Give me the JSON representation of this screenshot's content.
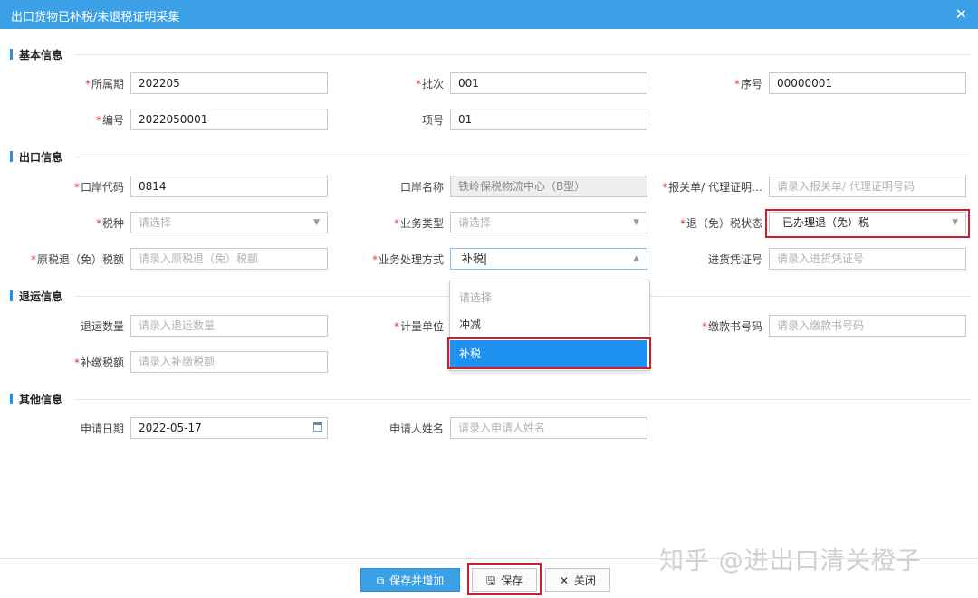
{
  "dialog": {
    "title": "出口货物已补税/未退税证明采集",
    "close_icon": "close-icon"
  },
  "sections": {
    "basic": "基本信息",
    "export": "出口信息",
    "return": "退运信息",
    "other": "其他信息"
  },
  "basic": {
    "period_label": "所属期",
    "period_value": "202205",
    "batch_label": "批次",
    "batch_value": "001",
    "seq_label": "序号",
    "seq_value": "00000001",
    "code_label": "编号",
    "code_value": "2022050001",
    "item_label": "项号",
    "item_value": "01"
  },
  "export": {
    "port_code_label": "口岸代码",
    "port_code_value": "0814",
    "port_name_label": "口岸名称",
    "port_name_value": "铁岭保税物流中心（B型）",
    "declaration_label": "报关单/ 代理证明…",
    "declaration_placeholder": "请录入报关单/ 代理证明号码",
    "tax_type_label": "税种",
    "tax_type_placeholder": "请选择",
    "business_type_label": "业务类型",
    "business_type_placeholder": "请选择",
    "refund_status_label": "退（免）税状态",
    "refund_status_value": "已办理退（免）税",
    "orig_refund_label": "原税退（免）税额",
    "orig_refund_placeholder": "请录入原税退（免）税额",
    "handling_label": "业务处理方式",
    "handling_value": "补税",
    "purchase_label": "进货凭证号",
    "purchase_placeholder": "请录入进货凭证号"
  },
  "dropdown": {
    "options": [
      "请选择",
      "冲减",
      "补税"
    ],
    "selected": "补税"
  },
  "return": {
    "qty_label": "退运数量",
    "qty_placeholder": "请录入退运数量",
    "unit_label": "计量单位",
    "payment_label": "缴款书号码",
    "payment_placeholder": "请录入缴款书号码",
    "supp_tax_label": "补缴税额",
    "supp_tax_placeholder": "请录入补缴税额"
  },
  "other": {
    "date_label": "申请日期",
    "date_value": "2022-05-17",
    "applicant_label": "申请人姓名",
    "applicant_placeholder": "请录入申请人姓名"
  },
  "footer": {
    "save_add_label": "保存并增加",
    "save_label": "保存",
    "close_label": "关闭"
  },
  "watermark": "知乎 @进出口清关橙子",
  "colors": {
    "accent": "#3ca0e6",
    "highlight": "#cc1f2e",
    "selected_option": "#1e90f0",
    "required": "#e33333"
  }
}
